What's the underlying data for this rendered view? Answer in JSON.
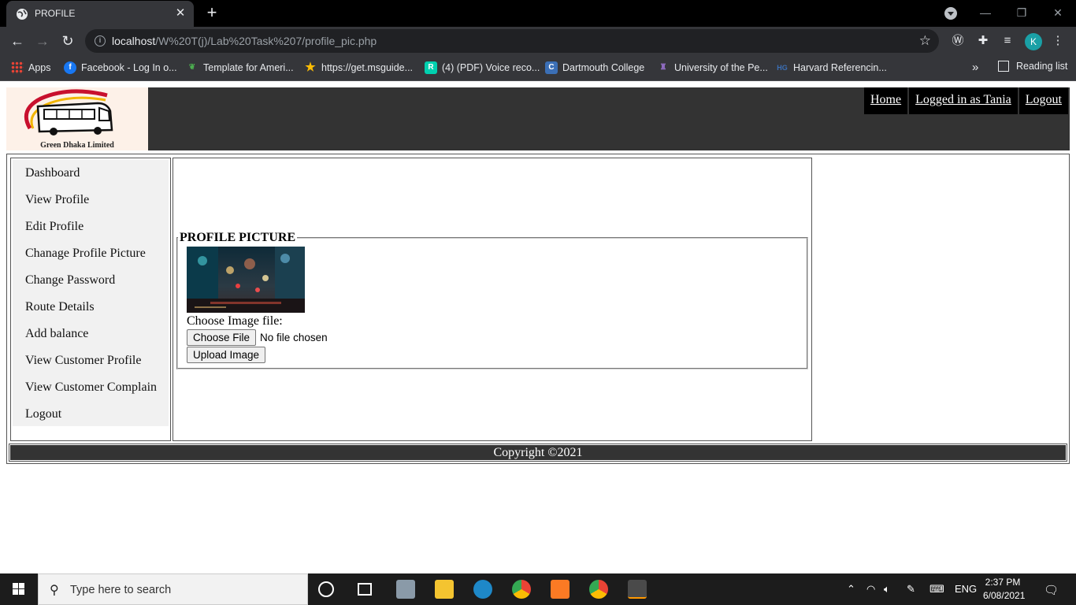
{
  "browser": {
    "tab_title": "PROFILE",
    "url_host": "localhost",
    "url_path": "/W%20T(j)/Lab%20Task%207/profile_pic.php",
    "avatar_letter": "K",
    "bookmarks": [
      {
        "label": "Apps",
        "icon": "apps-grid-icon",
        "color": "#ea4335"
      },
      {
        "label": "Facebook - Log In o...",
        "icon": "facebook-icon",
        "color": "#1877f2"
      },
      {
        "label": "Template for Ameri...",
        "icon": "leaf-icon",
        "color": "#4caf50"
      },
      {
        "label": "https://get.msguide...",
        "icon": "star-icon",
        "color": "#fbbc04"
      },
      {
        "label": "(4) (PDF) Voice reco...",
        "icon": "researchgate-icon",
        "color": "#00d0af"
      },
      {
        "label": "Dartmouth College",
        "icon": "dartmouth-icon",
        "color": "#3b6fb6"
      },
      {
        "label": "University of the Pe...",
        "icon": "university-icon",
        "color": "#8e6bbf"
      },
      {
        "label": "Harvard Referencin...",
        "icon": "harvard-icon",
        "color": "#3c4043"
      }
    ],
    "more_label": "»",
    "reading_list": "Reading list"
  },
  "page": {
    "logo_text": "Green Dhaka Limited",
    "topnav": [
      "Home",
      "Logged in as Tania",
      "Logout"
    ],
    "sidebar": [
      "Dashboard",
      "View Profile",
      "Edit Profile",
      "Chanage Profile Picture",
      "Change Password",
      "Route Details",
      "Add balance",
      "View Customer Profile",
      "View Customer Complain",
      "Logout"
    ],
    "form": {
      "legend": "PROFILE PICTURE",
      "file_label": "Choose Image file:",
      "choose_button": "Choose File",
      "no_file_text": "No file chosen",
      "upload_button": "Upload Image"
    },
    "footer": "Copyright ©2021"
  },
  "taskbar": {
    "search_placeholder": "Type here to search",
    "language": "ENG",
    "time": "2:37 PM",
    "date": "6/08/2021"
  },
  "colors": {
    "header_bg": "#333333",
    "chrome_dark": "#35363a"
  }
}
